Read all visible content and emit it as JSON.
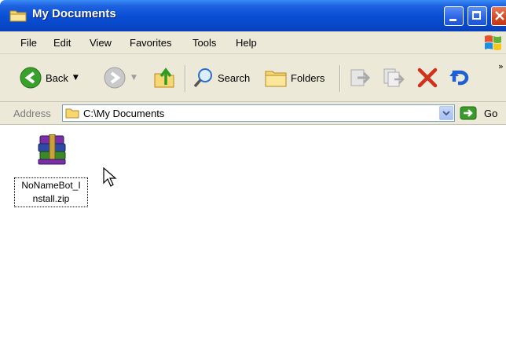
{
  "window": {
    "title": "My Documents"
  },
  "menu": {
    "items": [
      "File",
      "Edit",
      "View",
      "Favorites",
      "Tools",
      "Help"
    ]
  },
  "toolbar": {
    "back_label": "Back",
    "search_label": "Search",
    "folders_label": "Folders",
    "overflow": "»"
  },
  "address": {
    "label": "Address",
    "value": "C:\\My Documents",
    "go_label": "Go"
  },
  "files": [
    {
      "name": "NoNameBot_Install.zip",
      "name_line1": "NoNameBot_I",
      "name_line2": "nstall.zip",
      "icon": "winrar-archive-icon"
    }
  ],
  "colors": {
    "titlebar": "#0a4fd6",
    "chrome": "#ece9d8",
    "close": "#d8441f",
    "go_green": "#3a9a2a"
  }
}
